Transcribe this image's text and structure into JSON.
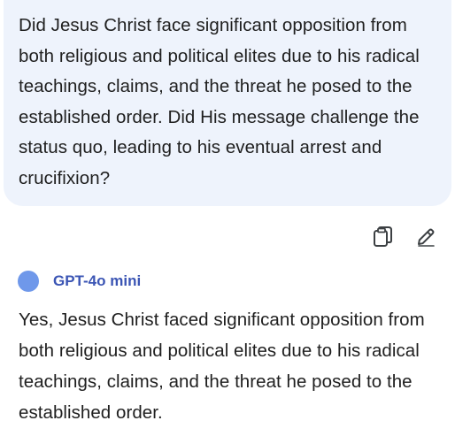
{
  "user_message": {
    "text": "Did Jesus Christ  face significant opposition from both religious and political elites due to his radical teachings, claims, and the threat he posed to the established order. Did His message challenge the status quo, leading to his eventual arrest and crucifixion?"
  },
  "actions": {
    "copy_icon": "copy-icon",
    "edit_icon": "pencil-icon"
  },
  "model": {
    "name": "GPT-4o mini",
    "dot_color": "#6f98ea"
  },
  "response": {
    "text": "Yes, Jesus Christ faced significant opposition from both religious and political elites due to his radical teachings, claims, and the threat he posed to the established order."
  },
  "colors": {
    "bubble_bg": "#eef3fc",
    "text": "#1f1f1f",
    "model_label": "#3b55b4"
  }
}
